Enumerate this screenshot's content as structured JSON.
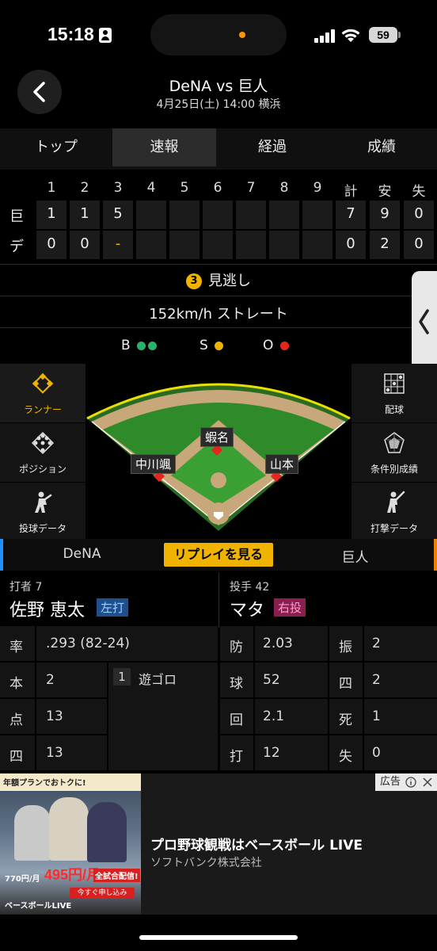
{
  "status_bar": {
    "time": "15:18",
    "battery": "59"
  },
  "header": {
    "title": "DeNA vs 巨人",
    "subtitle": "4月25日(土) 14:00 横浜"
  },
  "tabs": [
    {
      "label": "トップ",
      "active": false
    },
    {
      "label": "速報",
      "active": true
    },
    {
      "label": "経過",
      "active": false
    },
    {
      "label": "成績",
      "active": false
    }
  ],
  "scoreboard": {
    "innings": [
      "1",
      "2",
      "3",
      "4",
      "5",
      "6",
      "7",
      "8",
      "9"
    ],
    "totals_headers": [
      "計",
      "安",
      "失"
    ],
    "teams": [
      {
        "name": "巨",
        "innings": [
          "1",
          "1",
          "5",
          "",
          "",
          "",
          "",
          "",
          ""
        ],
        "totals": [
          "7",
          "9",
          "0"
        ]
      },
      {
        "name": "デ",
        "innings": [
          "0",
          "0",
          "-",
          "",
          "",
          "",
          "",
          "",
          ""
        ],
        "totals": [
          "0",
          "2",
          "0"
        ]
      }
    ]
  },
  "pitch": {
    "number": "3",
    "result": "見逃し",
    "detail": "152km/h ストレート",
    "bso": {
      "b_label": "B",
      "b_count": 2,
      "s_label": "S",
      "s_count": 1,
      "o_label": "O",
      "o_count": 1
    },
    "colors": {
      "ball": "#27b36b",
      "strike": "#f0b400",
      "out": "#e5261f"
    }
  },
  "side_buttons": {
    "left": [
      {
        "label": "ランナー",
        "icon": "diamond-icon",
        "active": true
      },
      {
        "label": "ポジション",
        "icon": "positions-icon",
        "active": false
      },
      {
        "label": "投球データ",
        "icon": "pitcher-icon",
        "active": false
      }
    ],
    "right": [
      {
        "label": "配球",
        "icon": "strike-zone-icon"
      },
      {
        "label": "条件別成績",
        "icon": "radar-chart-icon"
      },
      {
        "label": "打撃データ",
        "icon": "batter-icon"
      }
    ]
  },
  "field": {
    "second_base_runner": "蝦名",
    "first_base_runner": "山本",
    "third_base_runner": "中川颯"
  },
  "replay": {
    "left_team": "DeNA",
    "button": "リプレイを見る",
    "right_team": "巨人"
  },
  "batter": {
    "label": "打者 7",
    "name": "佐野 恵太",
    "badge": "左打",
    "stats": [
      {
        "key": "率",
        "value": ".293 (82-24)"
      },
      {
        "key": "本",
        "value": "2"
      },
      {
        "key": "点",
        "value": "13"
      },
      {
        "key": "四",
        "value": "13"
      }
    ],
    "at_bat": {
      "num": "1",
      "result": "遊ゴロ"
    }
  },
  "pitcher": {
    "label": "投手 42",
    "name": "マタ",
    "badge": "右投",
    "stats": [
      {
        "key": "防",
        "value": "2.03"
      },
      {
        "key": "振",
        "value": "2"
      },
      {
        "key": "球",
        "value": "52"
      },
      {
        "key": "四",
        "value": "2"
      },
      {
        "key": "回",
        "value": "2.1"
      },
      {
        "key": "死",
        "value": "1"
      },
      {
        "key": "打",
        "value": "12"
      },
      {
        "key": "失",
        "value": "0"
      }
    ]
  },
  "ad": {
    "label": "広告",
    "title": "プロ野球観戦はベースボール LIVE",
    "advertiser": "ソフトバンク株式会社",
    "banner_top": "年額プランでおトクに!",
    "banner_price_old": "770円/月",
    "banner_price_new": "495円/月",
    "banner_cta": "全試合配信!",
    "banner_button": "今すぐ申し込み",
    "banner_brand": "ベースボールLIVE"
  }
}
